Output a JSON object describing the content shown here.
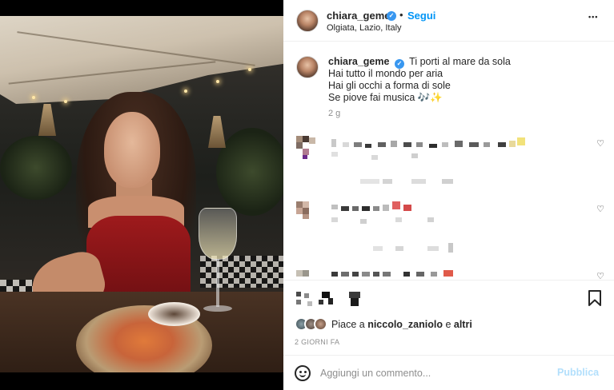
{
  "header": {
    "username": "chiara_geme",
    "separator": "•",
    "follow_label": "Segui",
    "location": "Olgiata, Lazio, Italy",
    "more_label": "•••"
  },
  "caption": {
    "username": "chiara_geme",
    "lines": [
      "Ti porti al mare da sola",
      "Hai tutto il mondo per aria",
      "Hai gli occhi a forma di sole",
      "Se piove fai musica 🎶✨"
    ],
    "time": "2 g"
  },
  "likes": {
    "prefix": "Piace a",
    "user": "niccolo_zaniolo",
    "conjunction": "e",
    "others": "altri"
  },
  "date": "2 GIORNI FA",
  "comment_bar": {
    "placeholder": "Aggiungi un commento...",
    "publish_label": "Pubblica"
  },
  "icons": {
    "verified": "verified-badge-icon",
    "more": "more-options-icon",
    "heart": "heart-outline-icon",
    "bookmark": "bookmark-icon",
    "emoji": "emoji-icon"
  },
  "colors": {
    "accent": "#0095f6",
    "verified": "#3897f0",
    "muted": "#8e8e8e",
    "publish_disabled": "#b2dffc"
  }
}
